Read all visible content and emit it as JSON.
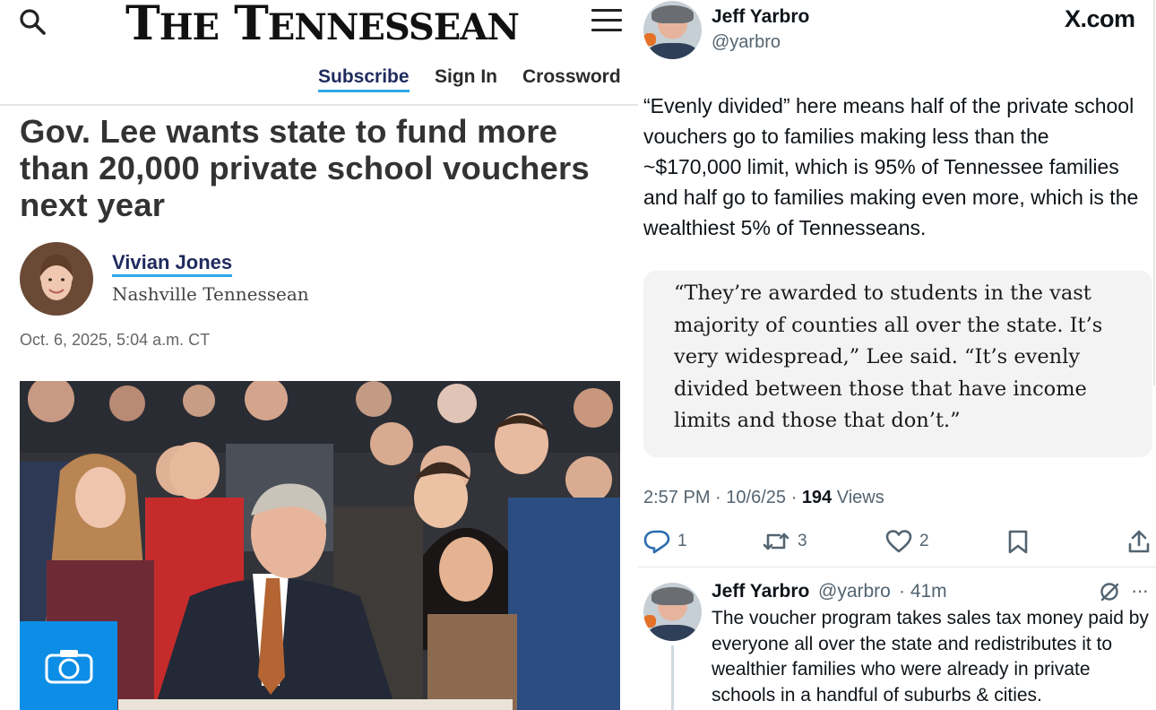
{
  "article": {
    "masthead": {
      "the": "T",
      "the_rest": "HE",
      "t": "T",
      "t_rest": "ENNESSEAN"
    },
    "nav": {
      "subscribe": "Subscribe",
      "sign_in": "Sign In",
      "crossword": "Crossword"
    },
    "headline": "Gov. Lee wants state to fund more than 20,000 private school vouchers next year",
    "author": {
      "name": "Vivian Jones",
      "organization": "Nashville Tennessean"
    },
    "date": "Oct. 6, 2025, 5:04 a.m. CT",
    "icons": {
      "search": "search-icon",
      "menu": "hamburger-menu-icon",
      "photo_gallery": "camera-icon"
    },
    "colors": {
      "link_underline": "#2fa8e8",
      "camera_button": "#0c8ee6"
    }
  },
  "post": {
    "display_name": "Jeff Yarbro",
    "handle": "@yarbro",
    "site_label": "X.com",
    "text": "“Evenly divided” here means half of the private school vouchers go to families making less than the ~$170,000 limit, which is 95% of Tennessee families and half go to families making even more, which is the wealthiest 5% of Tennesseans.",
    "quote": "“They’re awarded to students in the vast majority of counties all over the state. It’s very widespread,” Lee said. “It’s evenly divided between those that have income limits and those that don’t.”",
    "time": "2:57 PM",
    "date": "10/6/25",
    "sep": "·",
    "views_count": "194",
    "views_label": "Views",
    "actions": {
      "replies": "1",
      "reposts": "3",
      "likes": "2"
    }
  },
  "reply": {
    "display_name": "Jeff Yarbro",
    "handle": "@yarbro",
    "time": "· 41m",
    "more": "···",
    "text": "The voucher program takes sales tax money paid by everyone all over the state and redistributes it to wealthier families who were already in private schools in a handful of suburbs & cities."
  }
}
